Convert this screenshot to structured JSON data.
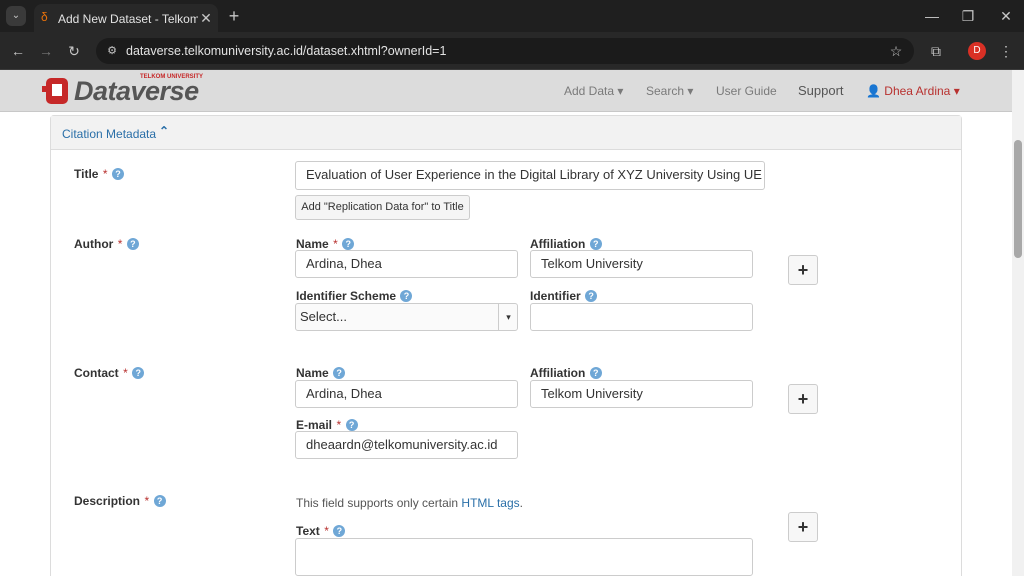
{
  "browser": {
    "tab_title": "Add New Dataset - Telkom Univ",
    "url": "dataverse.telkomuniversity.ac.id/dataset.xhtml?ownerId=1",
    "profile_initial": "D"
  },
  "navbar": {
    "brand": "Dataverse",
    "brand_super": "TELKOM UNIVERSITY",
    "add_data": "Add Data",
    "search": "Search",
    "user_guide": "User Guide",
    "support": "Support",
    "user": "Dhea Ardina"
  },
  "section": {
    "title": "Citation Metadata"
  },
  "title_field": {
    "label": "Title",
    "value": "Evaluation of User Experience in the Digital Library of XYZ University Using UE",
    "replication_button": "Add \"Replication Data for\" to Title"
  },
  "author": {
    "label": "Author",
    "name_label": "Name",
    "name_value": "Ardina, Dhea",
    "affiliation_label": "Affiliation",
    "affiliation_value": "Telkom University",
    "scheme_label": "Identifier Scheme",
    "scheme_value": "Select...",
    "identifier_label": "Identifier",
    "identifier_value": ""
  },
  "contact": {
    "label": "Contact",
    "name_label": "Name",
    "name_value": "Ardina, Dhea",
    "affiliation_label": "Affiliation",
    "affiliation_value": "Telkom University",
    "email_label": "E-mail",
    "email_value": "dheaardn@telkomuniversity.ac.id"
  },
  "description": {
    "label": "Description",
    "hint_prefix": "This field supports only certain ",
    "hint_link": "HTML tags",
    "hint_suffix": ".",
    "text_label": "Text"
  },
  "colors": {
    "accent": "#2a6fa8",
    "required": "#b8312f",
    "user": "#b8312f"
  }
}
